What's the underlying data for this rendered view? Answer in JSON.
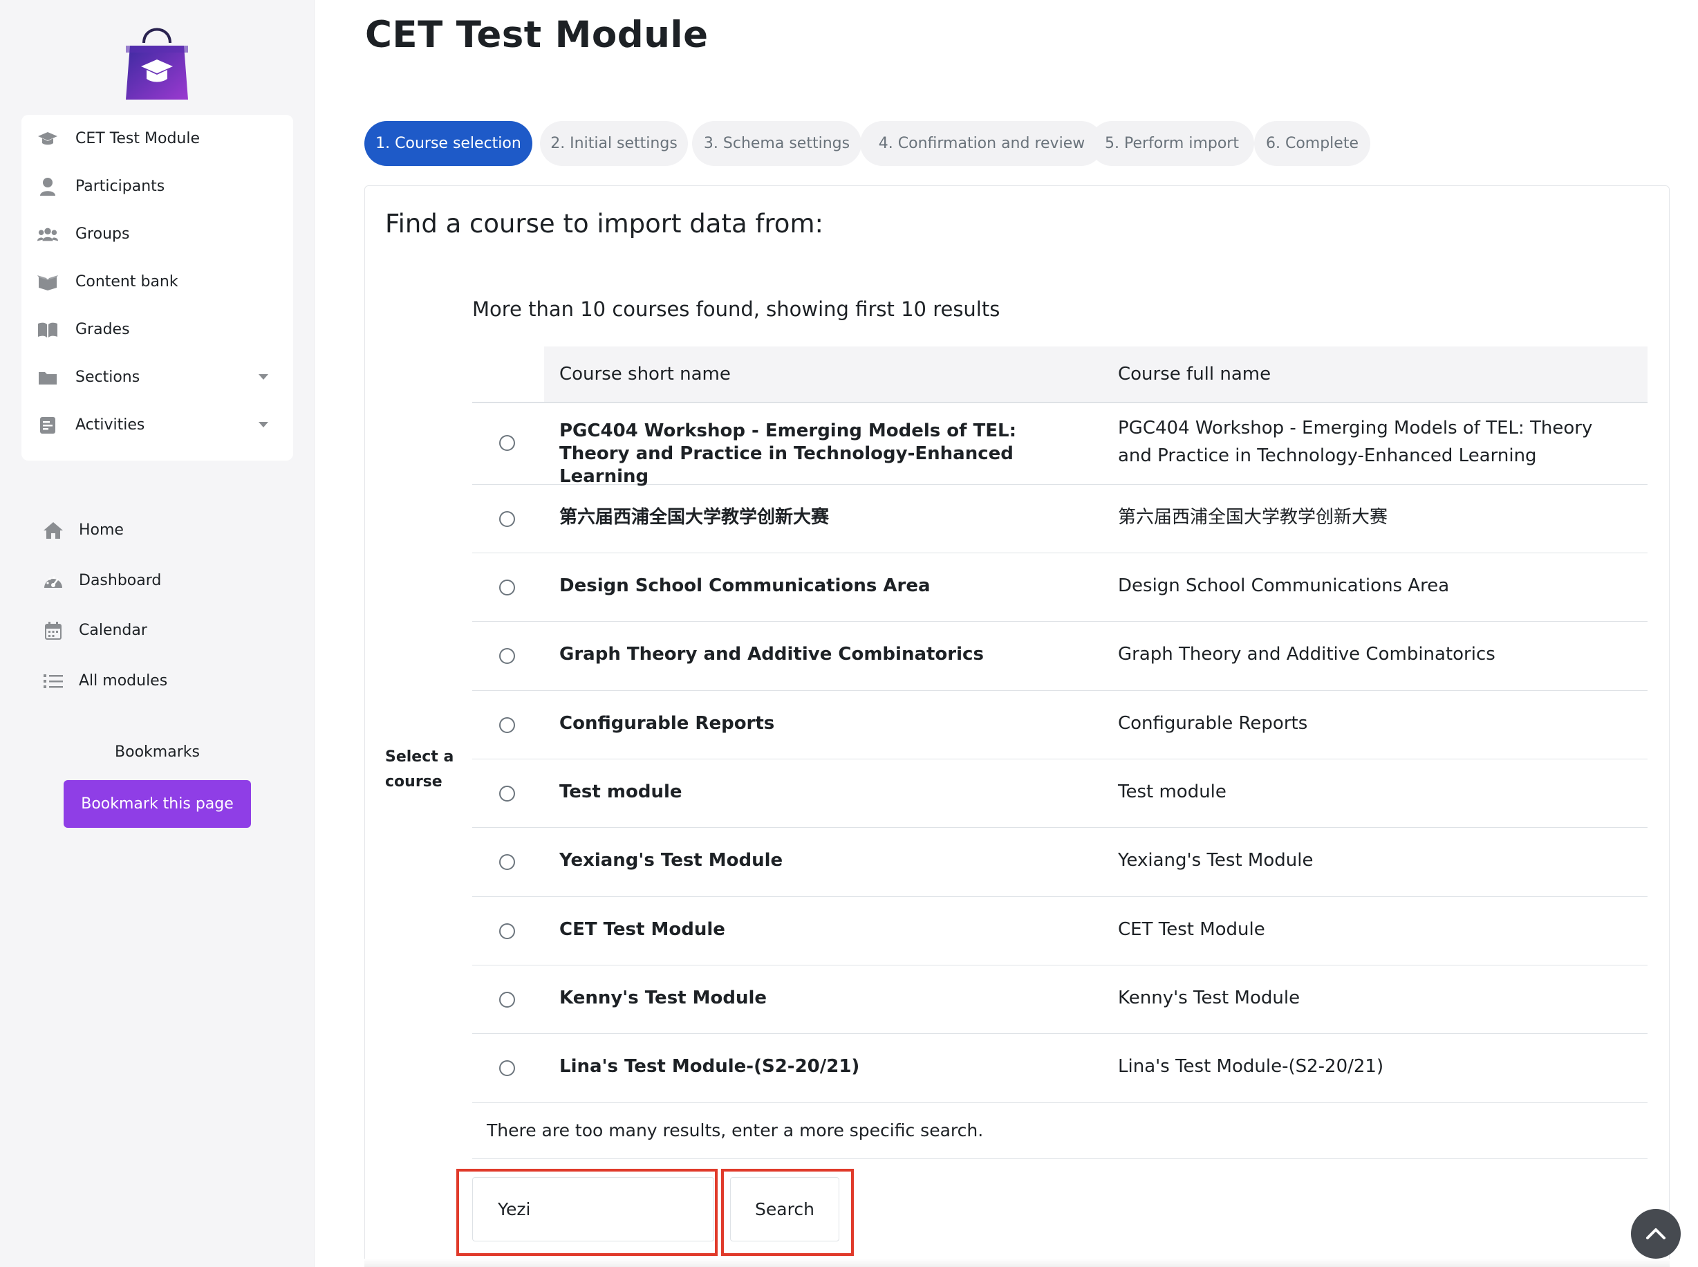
{
  "page": {
    "title": "CET Test Module"
  },
  "sidebar": {
    "course_nav": [
      {
        "label": "CET Test Module",
        "icon": "graduation-cap-icon"
      },
      {
        "label": "Participants",
        "icon": "user-icon"
      },
      {
        "label": "Groups",
        "icon": "users-icon"
      },
      {
        "label": "Content bank",
        "icon": "box-open-icon"
      },
      {
        "label": "Grades",
        "icon": "book-open-icon"
      },
      {
        "label": "Sections",
        "icon": "folder-icon"
      },
      {
        "label": "Activities",
        "icon": "file-list-icon"
      }
    ],
    "site_nav": [
      {
        "label": "Home",
        "icon": "home-icon"
      },
      {
        "label": "Dashboard",
        "icon": "gauge-icon"
      },
      {
        "label": "Calendar",
        "icon": "calendar-icon"
      },
      {
        "label": "All modules",
        "icon": "list-icon"
      }
    ],
    "bookmarks": {
      "title": "Bookmarks",
      "button": "Bookmark this page"
    }
  },
  "stepper": [
    "1. Course selection",
    "2. Initial settings",
    "3. Schema settings",
    "4. Confirmation and review",
    "5. Perform import",
    "6. Complete"
  ],
  "main": {
    "heading": "Find a course to import data from:",
    "results_note": "More than 10 courses found, showing first 10 results",
    "select_label": "Select a course",
    "columns": [
      "Course short name",
      "Course full name"
    ],
    "rows": [
      {
        "short": "PGC404 Workshop - Emerging Models of TEL: Theory and Practice in Technology-Enhanced Learning",
        "full": "PGC404 Workshop - Emerging Models of TEL: Theory and Practice in Technology-Enhanced Learning"
      },
      {
        "short": "第六届西浦全国大学教学创新大赛",
        "full": "第六届西浦全国大学教学创新大赛"
      },
      {
        "short": "Design School Communications Area",
        "full": "Design School Communications Area"
      },
      {
        "short": "Graph Theory and Additive Combinatorics",
        "full": "Graph Theory and Additive Combinatorics"
      },
      {
        "short": "Configurable Reports",
        "full": "Configurable Reports"
      },
      {
        "short": "Test module",
        "full": "Test module"
      },
      {
        "short": "Yexiang's Test Module",
        "full": "Yexiang's Test Module"
      },
      {
        "short": "CET Test Module",
        "full": "CET Test Module"
      },
      {
        "short": "Kenny's Test Module",
        "full": "Kenny's Test Module"
      },
      {
        "short": "Lina's Test Module-(S2-20/21)",
        "full": "Lina's Test Module-(S2-20/21)"
      }
    ],
    "too_many": "There are too many results, enter a more specific search.",
    "search": {
      "value": "Yezi",
      "button": "Search"
    }
  },
  "colors": {
    "accent": "#1e5ac8",
    "bookmark": "#8f3ee6",
    "highlight": "#e03a2a",
    "logo_purple": "#6a2bb8"
  }
}
